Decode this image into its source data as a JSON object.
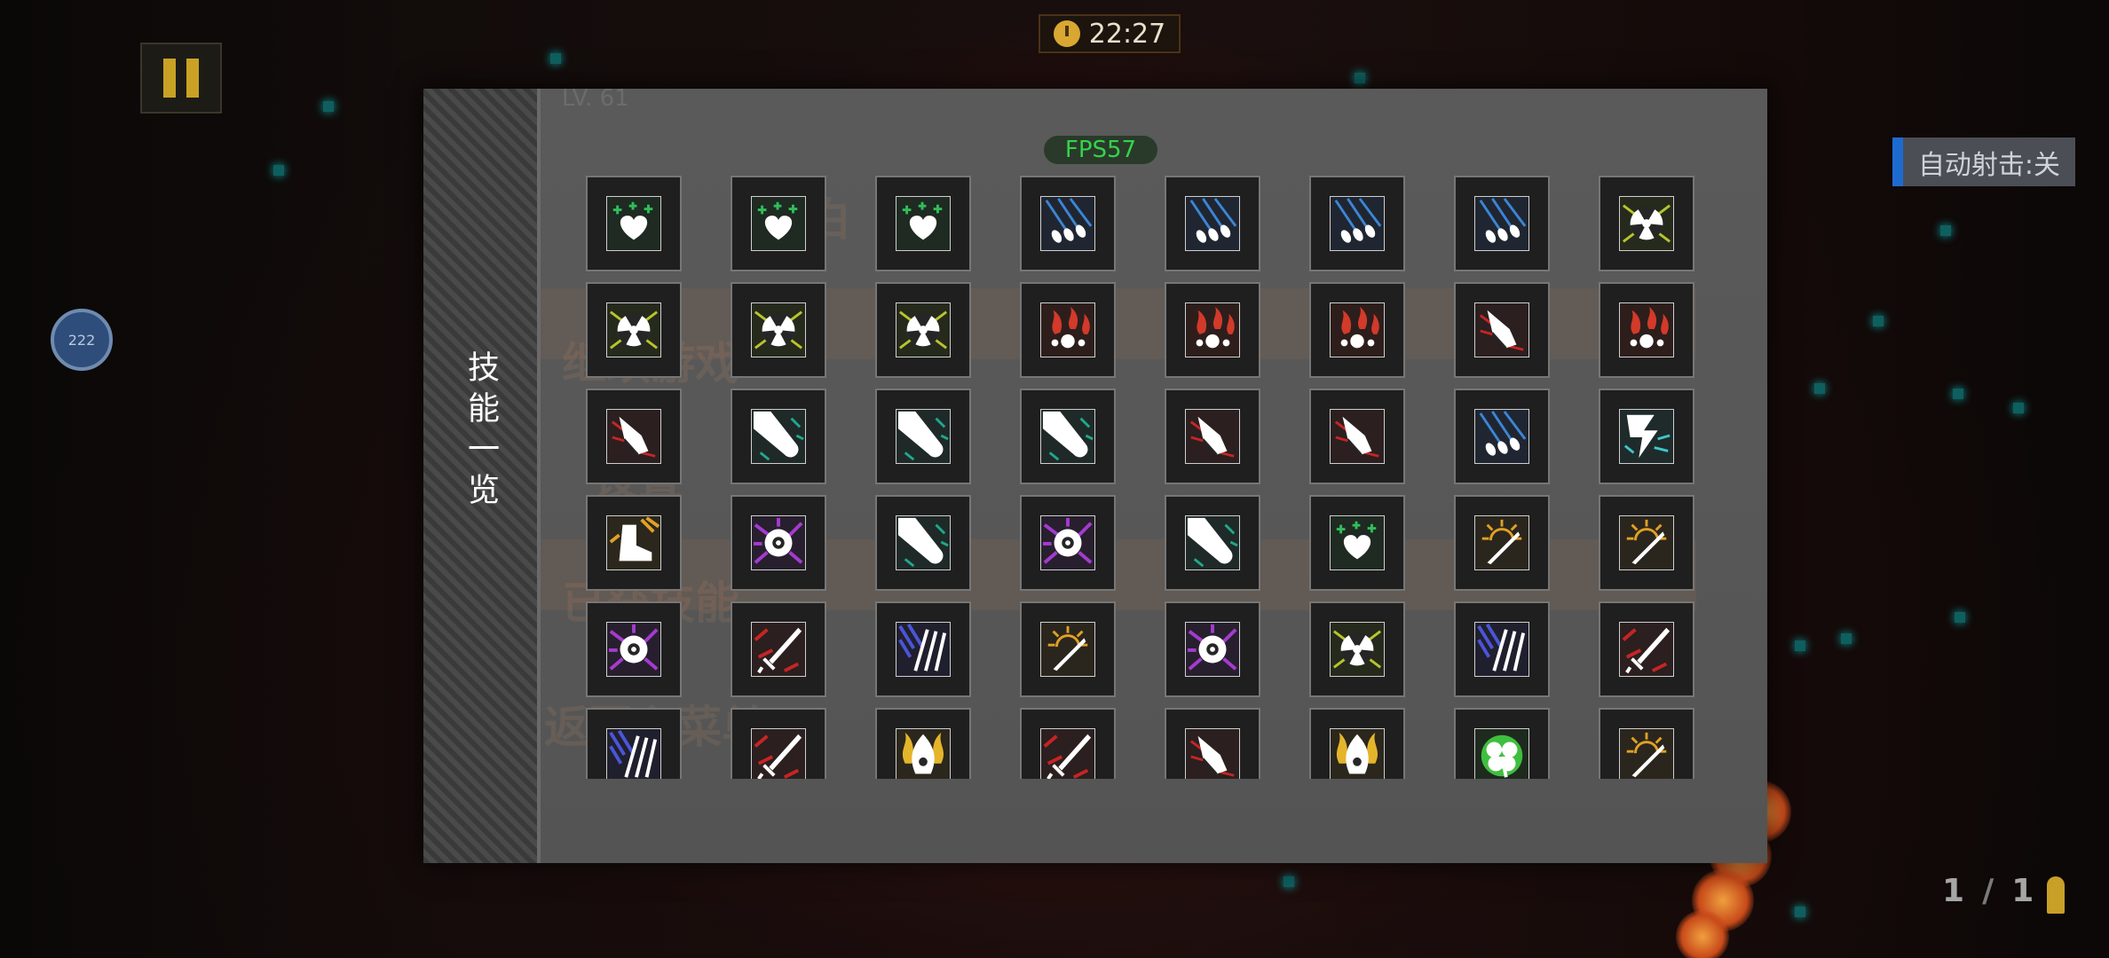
{
  "hud": {
    "timer": "22:27",
    "level_badge": "222",
    "auto_fire": "自动射击:关",
    "ammo_current": "1",
    "ammo_sep": "/",
    "ammo_max": "1"
  },
  "panel": {
    "title": "技能一览",
    "fps": "FPS57",
    "bg_level_text": "LV. 61",
    "bg_menu_items": [
      "白",
      "继续游戏",
      "设置",
      "已获技能",
      "返回主菜单"
    ]
  },
  "skills": [
    [
      "heal-hearts",
      "crystal-shards",
      "crystal-shards",
      "blue-feathers",
      "blue-feathers",
      "blue-feathers",
      "blue-feathers",
      "radiation-burst"
    ],
    [
      "radiation-burst",
      "radiation-burst",
      "radiation-burst",
      "fire-orbs",
      "fire-orbs",
      "fire-orbs",
      "red-gauntlet",
      "fire-orbs"
    ],
    [
      "red-gauntlet",
      "light-beam",
      "light-beam",
      "light-beam",
      "red-gauntlet",
      "red-gauntlet",
      "blue-feathers",
      "lightning-strike"
    ],
    [
      "golden-boot",
      "void-eye",
      "light-beam",
      "void-eye",
      "light-beam",
      "heal-hearts",
      "sun-blade",
      "sun-blade"
    ],
    [
      "void-eye",
      "red-sword",
      "blue-swords",
      "sun-blade",
      "void-eye",
      "radiation-burst",
      "blue-swords",
      "red-sword"
    ],
    [
      "blue-swords",
      "red-sword",
      "holy-flame",
      "red-sword",
      "red-gauntlet",
      "holy-flame",
      "lucky-clover",
      "sun-blade"
    ]
  ],
  "colors": {
    "heal": "#2fbf5a",
    "feather": "#3b86d6",
    "radiation": "#b8c42c",
    "fire": "#d23a2a",
    "beam": "#1fa88c",
    "void": "#a43bd0",
    "sun": "#e0a126",
    "sword_red": "#c62525",
    "sword_blue": "#4a55d8",
    "flame": "#e4b52b",
    "clover": "#3fbf3f",
    "lightning": "#3cc8c8",
    "fps": "#34d34a",
    "autofire_accent": "#1e6bd0"
  }
}
